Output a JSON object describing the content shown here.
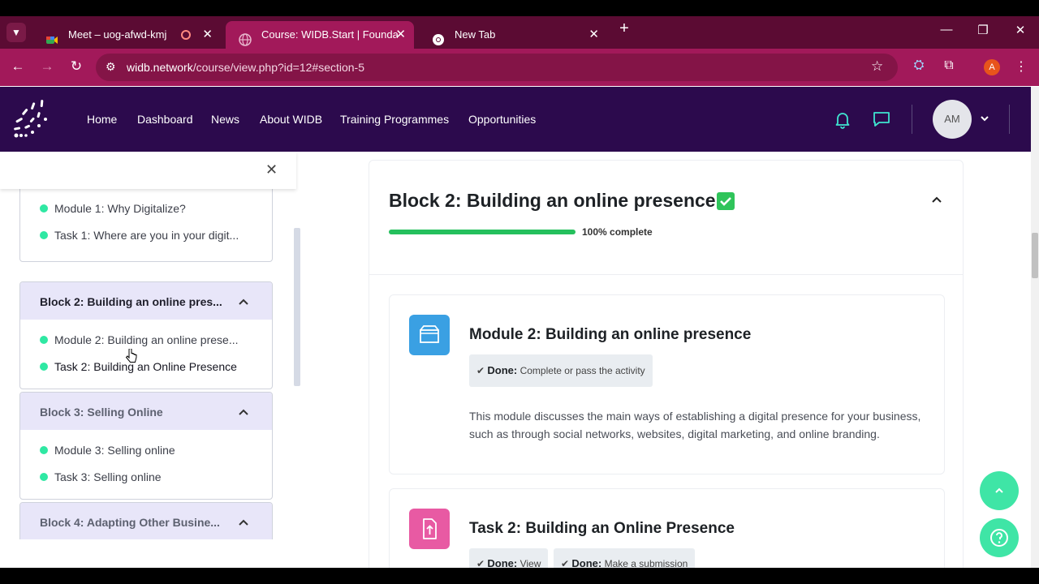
{
  "browser": {
    "tabs": [
      {
        "title": "Meet – uog-afwd-kmj",
        "favicon": "meet-icon"
      },
      {
        "title": "Course: WIDB.Start | Foundation",
        "favicon": "globe-icon"
      },
      {
        "title": "New Tab",
        "favicon": "chrome-icon"
      }
    ],
    "url_domain": "widb.network",
    "url_path": "/course/view.php?id=12#section-5",
    "profile_initial": "A"
  },
  "site": {
    "nav": [
      "Home",
      "Dashboard",
      "News",
      "About WIDB",
      "Training Programmes",
      "Opportunities"
    ],
    "user_initials": "AM",
    "colors": {
      "header": "#2c0a4d",
      "accent": "#3fe5a6"
    }
  },
  "drawer": {
    "block1_items": [
      "Module 1: Why Digitalize?",
      "Task 1: Where are you in your digit..."
    ],
    "block2": {
      "title": "Block 2: Building an online pres...",
      "items": [
        "Module 2: Building an online prese...",
        "Task 2: Building an Online Presence"
      ]
    },
    "block3": {
      "title": "Block 3: Selling Online",
      "items": [
        "Module 3: Selling online",
        "Task 3: Selling online"
      ]
    },
    "block4": {
      "title": "Block 4: Adapting Other Busine..."
    }
  },
  "section": {
    "title": "Block 2: Building an online presence",
    "progress_label": "100% complete",
    "progress": 1.0
  },
  "activities": [
    {
      "title": "Module 2: Building an online presence",
      "icon": "box-icon",
      "badges": [
        {
          "label": "Done:",
          "text": "Complete or pass the activity"
        }
      ],
      "description": "This module discusses the main ways of establishing a digital presence for your business, such as through social networks, websites, digital marketing, and online branding."
    },
    {
      "title": "Task 2: Building an Online Presence",
      "icon": "file-upload-icon",
      "badges": [
        {
          "label": "Done:",
          "text": "View"
        },
        {
          "label": "Done:",
          "text": "Make a submission"
        }
      ]
    }
  ]
}
